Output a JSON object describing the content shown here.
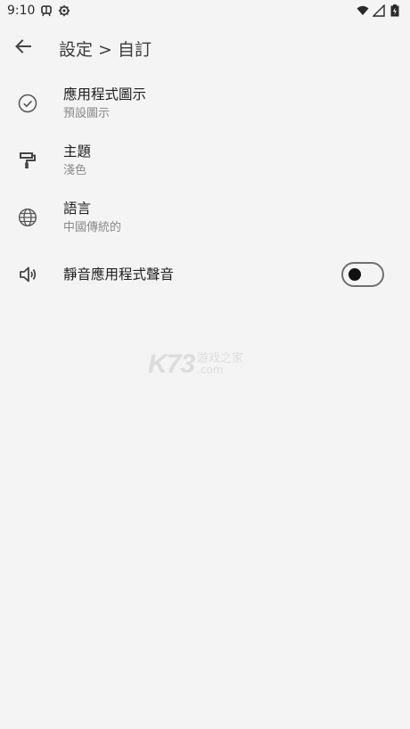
{
  "status_bar": {
    "time": "9:10",
    "left_icons": [
      "debug-icon",
      "settings-gear-icon"
    ],
    "right_icons": [
      "wifi-icon",
      "signal-icon",
      "battery-icon"
    ]
  },
  "app_bar": {
    "title": "設定 > 自訂",
    "back_icon": "arrow-back-icon"
  },
  "settings": [
    {
      "icon": "check-circle-icon",
      "title": "應用程式圖示",
      "subtitle": "預設圖示"
    },
    {
      "icon": "paint-roller-icon",
      "title": "主題",
      "subtitle": "淺色"
    },
    {
      "icon": "globe-icon",
      "title": "語言",
      "subtitle": "中國傳統的"
    },
    {
      "icon": "volume-icon",
      "title": "靜音應用程式聲音",
      "toggle_on": false
    }
  ],
  "watermark": {
    "main": "K73",
    "cn": "游戏之家",
    "com": ".com"
  },
  "colors": {
    "background": "#f4f4f4",
    "text_primary": "#1f1f1f",
    "text_secondary": "#8a8a8a"
  }
}
